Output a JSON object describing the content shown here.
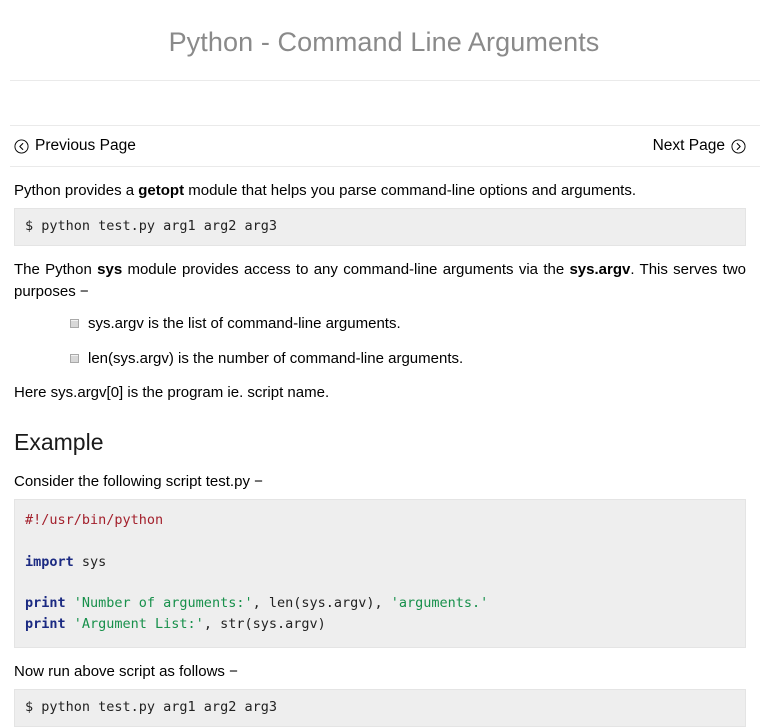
{
  "header": {
    "title": "Python - Command Line Arguments"
  },
  "nav": {
    "previous_label": "Previous Page",
    "previous_icon": "chevron-left-circle-icon",
    "next_label": "Next Page",
    "next_icon": "chevron-right-circle-icon"
  },
  "content": {
    "intro_paragraph": {
      "before": "Python provides a ",
      "bold": "getopt",
      "after": " module that helps you parse command-line options and arguments."
    },
    "terminal_1": "$ python test.py arg1 arg2 arg3",
    "sys_paragraph": {
      "part1": "The Python ",
      "bold1": "sys",
      "part2": " module provides access to any command-line arguments via the ",
      "bold2": "sys.argv",
      "part3": ". This serves two purposes −"
    },
    "bullets": [
      "sys.argv is the list of command-line arguments.",
      "len(sys.argv) is the number of command-line arguments."
    ],
    "argv_zero_note": "Here sys.argv[0] is the program ie. script name.",
    "example_heading": "Example",
    "consider_note": "Consider the following script test.py −",
    "script": {
      "shebang": "#!/usr/bin/python",
      "blank1": "",
      "import_keyword": "import",
      "import_module": " sys",
      "blank2": "",
      "line3_kw": "print",
      "line3_str1": " 'Number of arguments:'",
      "line3_mid": ", len(sys.argv), ",
      "line3_str2": "'arguments.'",
      "line4_kw": "print",
      "line4_str1": " 'Argument List:'",
      "line4_mid": ", str(sys.argv)"
    },
    "run_note": "Now run above script as follows −",
    "terminal_2": "$ python test.py arg1 arg2 arg3"
  },
  "colors": {
    "title_gray": "#8a8a8a",
    "code_background": "#eeeeee",
    "comment_red": "#a3202c",
    "keyword_blue": "#1b2a82",
    "string_green": "#17904b",
    "rule_gray": "#eaeaea"
  }
}
